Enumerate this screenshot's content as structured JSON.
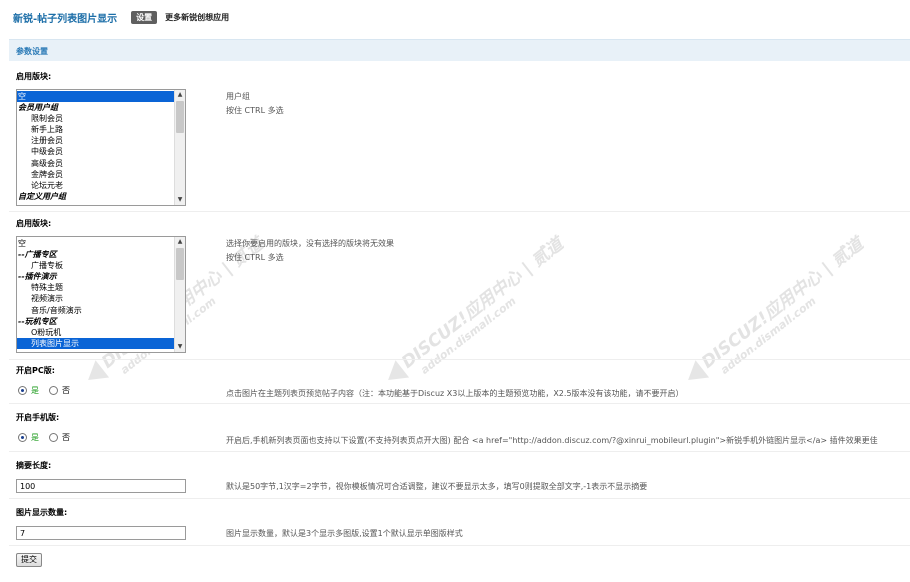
{
  "header": {
    "title": "新锐-帖子列表图片显示",
    "settings_label": "设置",
    "more_label": "更多新锐创想应用"
  },
  "section": {
    "title": "参数设置"
  },
  "watermark": {
    "line1": "DISCUZ!应用中心 | 贰道",
    "line2": "addon.dismall.com"
  },
  "usergroups": {
    "label": "启用版块:",
    "options": [
      {
        "text": "空",
        "type": "item",
        "selected": true
      },
      {
        "text": "会员用户组",
        "type": "group"
      },
      {
        "text": "限制会员",
        "type": "indent"
      },
      {
        "text": "新手上路",
        "type": "indent"
      },
      {
        "text": "注册会员",
        "type": "indent"
      },
      {
        "text": "中级会员",
        "type": "indent"
      },
      {
        "text": "高级会员",
        "type": "indent"
      },
      {
        "text": "金牌会员",
        "type": "indent"
      },
      {
        "text": "论坛元老",
        "type": "indent"
      },
      {
        "text": "自定义用户组",
        "type": "group"
      }
    ],
    "desc_line1": "用户组",
    "desc_line2": "按住 CTRL 多选"
  },
  "forums": {
    "label": "启用版块:",
    "options": [
      {
        "text": "空",
        "type": "item"
      },
      {
        "text": "--广播专区",
        "type": "group"
      },
      {
        "text": "广播专板",
        "type": "indent"
      },
      {
        "text": "--插件演示",
        "type": "group"
      },
      {
        "text": "特殊主题",
        "type": "indent"
      },
      {
        "text": "视频演示",
        "type": "indent"
      },
      {
        "text": "音乐/音频演示",
        "type": "indent"
      },
      {
        "text": "--玩机专区",
        "type": "group"
      },
      {
        "text": "O粉玩机",
        "type": "indent"
      },
      {
        "text": "列表图片显示",
        "type": "indent",
        "selected": true
      }
    ],
    "desc_line1": "选择你要启用的版块，没有选择的版块将无效果",
    "desc_line2": "按住 CTRL 多选"
  },
  "pc": {
    "label": "开启PC版:",
    "yes": "是",
    "no": "否",
    "desc": "点击图片在主题列表页预览帖子内容（注：本功能基于Discuz X3以上版本的主题预览功能，X2.5版本没有该功能，请不要开启）"
  },
  "mobile": {
    "label": "开启手机版:",
    "yes": "是",
    "no": "否",
    "desc": "开启后,手机新列表页面也支持以下设置(不支持列表页点开大图) 配合 <a href=\"http://addon.discuz.com/?@xinrui_mobileurl.plugin\">新锐手机外链图片显示</a> 插件效果更佳"
  },
  "summary": {
    "label": "摘要长度:",
    "value": "100",
    "desc": "默认是50字节,1汉字=2字节，视你模板情况可合适调整，建议不要显示太多，填写0则提取全部文字,-1表示不显示摘要"
  },
  "imgcount": {
    "label": "图片显示数量:",
    "value": "7",
    "desc": "图片显示数量，默认是3个显示多图版,设置1个默认显示单图版样式"
  },
  "submit_label": "提交"
}
